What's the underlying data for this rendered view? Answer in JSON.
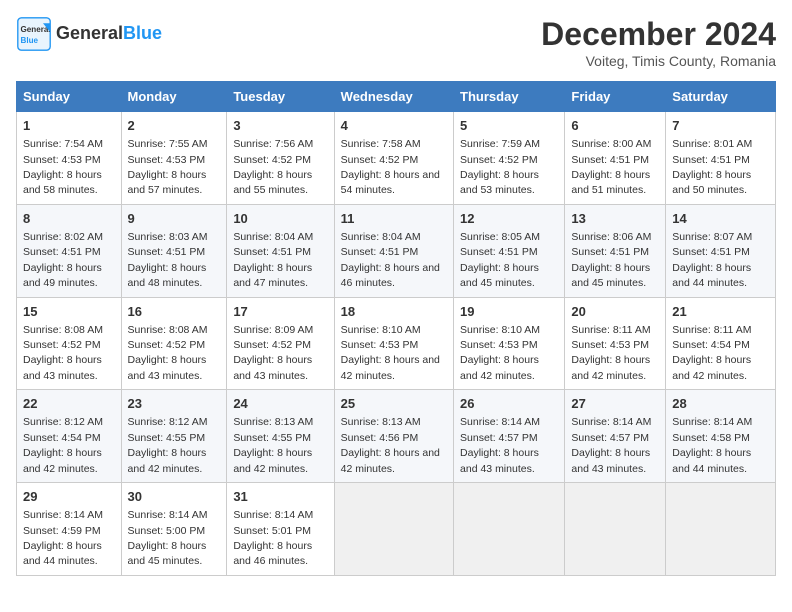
{
  "header": {
    "logo_general": "General",
    "logo_blue": "Blue",
    "title": "December 2024",
    "subtitle": "Voiteg, Timis County, Romania"
  },
  "weekdays": [
    "Sunday",
    "Monday",
    "Tuesday",
    "Wednesday",
    "Thursday",
    "Friday",
    "Saturday"
  ],
  "weeks": [
    [
      {
        "day": "1",
        "sunrise": "7:54 AM",
        "sunset": "4:53 PM",
        "daylight": "8 hours and 58 minutes."
      },
      {
        "day": "2",
        "sunrise": "7:55 AM",
        "sunset": "4:53 PM",
        "daylight": "8 hours and 57 minutes."
      },
      {
        "day": "3",
        "sunrise": "7:56 AM",
        "sunset": "4:52 PM",
        "daylight": "8 hours and 55 minutes."
      },
      {
        "day": "4",
        "sunrise": "7:58 AM",
        "sunset": "4:52 PM",
        "daylight": "8 hours and 54 minutes."
      },
      {
        "day": "5",
        "sunrise": "7:59 AM",
        "sunset": "4:52 PM",
        "daylight": "8 hours and 53 minutes."
      },
      {
        "day": "6",
        "sunrise": "8:00 AM",
        "sunset": "4:51 PM",
        "daylight": "8 hours and 51 minutes."
      },
      {
        "day": "7",
        "sunrise": "8:01 AM",
        "sunset": "4:51 PM",
        "daylight": "8 hours and 50 minutes."
      }
    ],
    [
      {
        "day": "8",
        "sunrise": "8:02 AM",
        "sunset": "4:51 PM",
        "daylight": "8 hours and 49 minutes."
      },
      {
        "day": "9",
        "sunrise": "8:03 AM",
        "sunset": "4:51 PM",
        "daylight": "8 hours and 48 minutes."
      },
      {
        "day": "10",
        "sunrise": "8:04 AM",
        "sunset": "4:51 PM",
        "daylight": "8 hours and 47 minutes."
      },
      {
        "day": "11",
        "sunrise": "8:04 AM",
        "sunset": "4:51 PM",
        "daylight": "8 hours and 46 minutes."
      },
      {
        "day": "12",
        "sunrise": "8:05 AM",
        "sunset": "4:51 PM",
        "daylight": "8 hours and 45 minutes."
      },
      {
        "day": "13",
        "sunrise": "8:06 AM",
        "sunset": "4:51 PM",
        "daylight": "8 hours and 45 minutes."
      },
      {
        "day": "14",
        "sunrise": "8:07 AM",
        "sunset": "4:51 PM",
        "daylight": "8 hours and 44 minutes."
      }
    ],
    [
      {
        "day": "15",
        "sunrise": "8:08 AM",
        "sunset": "4:52 PM",
        "daylight": "8 hours and 43 minutes."
      },
      {
        "day": "16",
        "sunrise": "8:08 AM",
        "sunset": "4:52 PM",
        "daylight": "8 hours and 43 minutes."
      },
      {
        "day": "17",
        "sunrise": "8:09 AM",
        "sunset": "4:52 PM",
        "daylight": "8 hours and 43 minutes."
      },
      {
        "day": "18",
        "sunrise": "8:10 AM",
        "sunset": "4:53 PM",
        "daylight": "8 hours and 42 minutes."
      },
      {
        "day": "19",
        "sunrise": "8:10 AM",
        "sunset": "4:53 PM",
        "daylight": "8 hours and 42 minutes."
      },
      {
        "day": "20",
        "sunrise": "8:11 AM",
        "sunset": "4:53 PM",
        "daylight": "8 hours and 42 minutes."
      },
      {
        "day": "21",
        "sunrise": "8:11 AM",
        "sunset": "4:54 PM",
        "daylight": "8 hours and 42 minutes."
      }
    ],
    [
      {
        "day": "22",
        "sunrise": "8:12 AM",
        "sunset": "4:54 PM",
        "daylight": "8 hours and 42 minutes."
      },
      {
        "day": "23",
        "sunrise": "8:12 AM",
        "sunset": "4:55 PM",
        "daylight": "8 hours and 42 minutes."
      },
      {
        "day": "24",
        "sunrise": "8:13 AM",
        "sunset": "4:55 PM",
        "daylight": "8 hours and 42 minutes."
      },
      {
        "day": "25",
        "sunrise": "8:13 AM",
        "sunset": "4:56 PM",
        "daylight": "8 hours and 42 minutes."
      },
      {
        "day": "26",
        "sunrise": "8:14 AM",
        "sunset": "4:57 PM",
        "daylight": "8 hours and 43 minutes."
      },
      {
        "day": "27",
        "sunrise": "8:14 AM",
        "sunset": "4:57 PM",
        "daylight": "8 hours and 43 minutes."
      },
      {
        "day": "28",
        "sunrise": "8:14 AM",
        "sunset": "4:58 PM",
        "daylight": "8 hours and 44 minutes."
      }
    ],
    [
      {
        "day": "29",
        "sunrise": "8:14 AM",
        "sunset": "4:59 PM",
        "daylight": "8 hours and 44 minutes."
      },
      {
        "day": "30",
        "sunrise": "8:14 AM",
        "sunset": "5:00 PM",
        "daylight": "8 hours and 45 minutes."
      },
      {
        "day": "31",
        "sunrise": "8:14 AM",
        "sunset": "5:01 PM",
        "daylight": "8 hours and 46 minutes."
      },
      null,
      null,
      null,
      null
    ]
  ],
  "labels": {
    "sunrise": "Sunrise:",
    "sunset": "Sunset:",
    "daylight": "Daylight:"
  }
}
